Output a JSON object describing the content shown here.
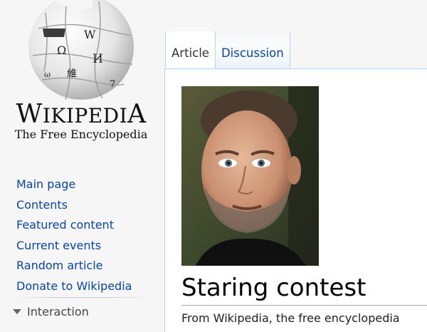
{
  "logo": {
    "wordmark": "WIKIPEDIA",
    "tagline": "The Free Encyclopedia",
    "glyphs": [
      "Ω",
      "W",
      "И",
      "維",
      "ω",
      "7"
    ]
  },
  "sidebar": {
    "items": [
      {
        "label": "Main page"
      },
      {
        "label": "Contents"
      },
      {
        "label": "Featured content"
      },
      {
        "label": "Current events"
      },
      {
        "label": "Random article"
      },
      {
        "label": "Donate to Wikipedia"
      }
    ],
    "portal_heading": "Interaction"
  },
  "tabs": [
    {
      "label": "Article",
      "selected": true
    },
    {
      "label": "Discussion",
      "selected": false
    }
  ],
  "article": {
    "title": "Staring contest",
    "tagline": "From Wikipedia, the free encyclopedia",
    "image_subject": "portrait-photo"
  },
  "colors": {
    "link": "#0645ad",
    "tab_border": "#a7d7f9",
    "sidebar_bg": "#f6f6f6",
    "content_bg": "#ffffff"
  }
}
